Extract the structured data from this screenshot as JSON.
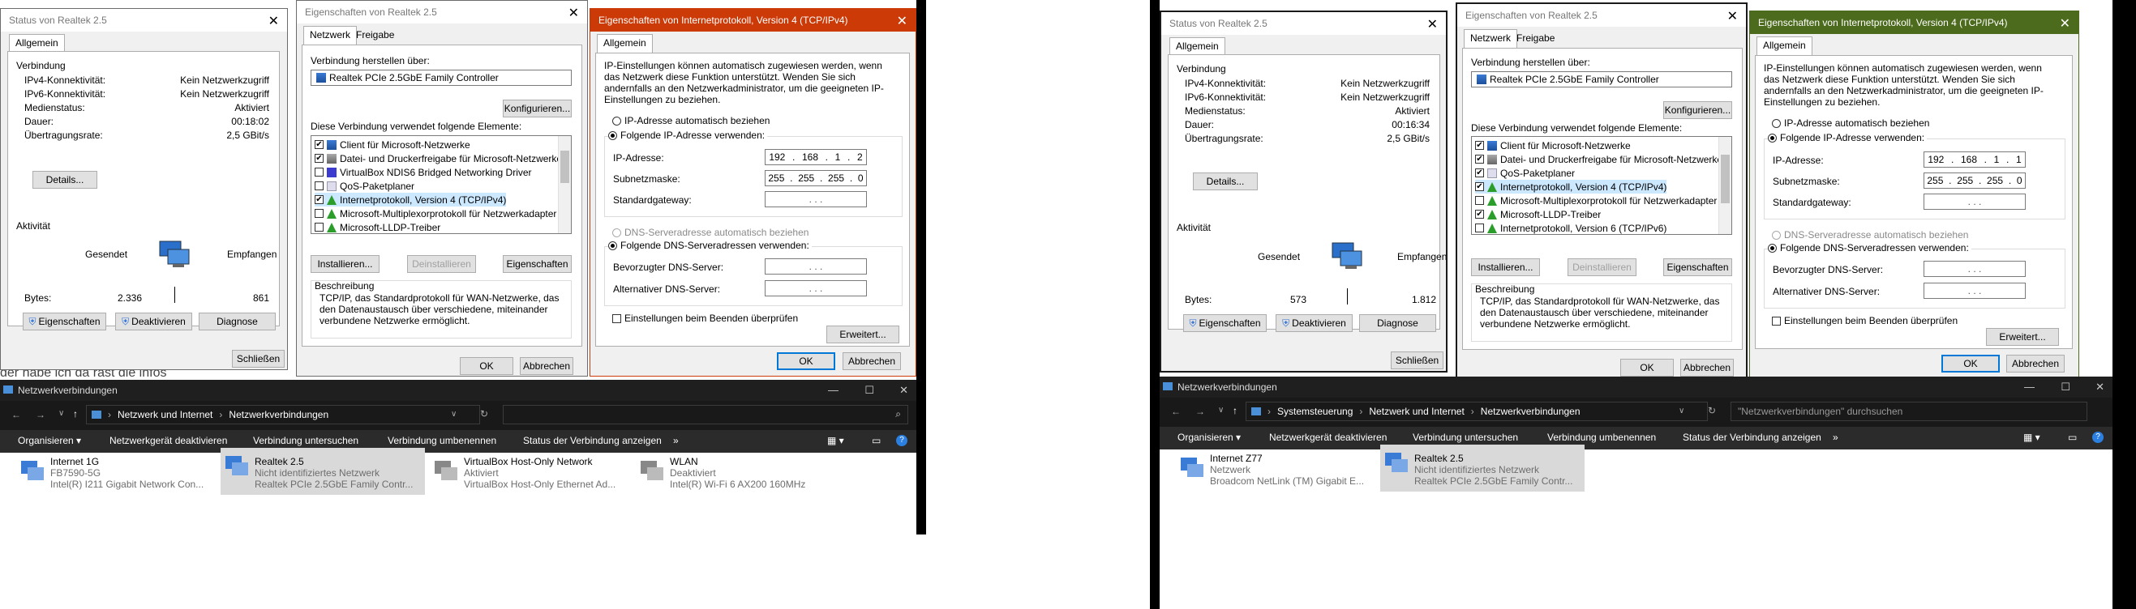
{
  "left": {
    "status": {
      "title": "Status von Realtek 2.5",
      "tab": "Allgemein",
      "group_connection": "Verbindung",
      "rows": [
        {
          "label": "IPv4-Konnektivität:",
          "value": "Kein Netzwerkzugriff"
        },
        {
          "label": "IPv6-Konnektivität:",
          "value": "Kein Netzwerkzugriff"
        },
        {
          "label": "Medienstatus:",
          "value": "Aktiviert"
        },
        {
          "label": "Dauer:",
          "value": "00:18:02"
        },
        {
          "label": "Übertragungsrate:",
          "value": "2,5 GBit/s"
        }
      ],
      "details_btn": "Details...",
      "group_activity": "Aktivität",
      "sent": "Gesendet",
      "received": "Empfangen",
      "bytes_label": "Bytes:",
      "bytes_sent": "2.336",
      "bytes_received": "861",
      "btn_props": "Eigenschaften",
      "btn_disable": "Deaktivieren",
      "btn_diag": "Diagnose",
      "btn_close": "Schließen"
    },
    "props": {
      "title": "Eigenschaften von Realtek 2.5",
      "tab1": "Netzwerk",
      "tab2": "Freigabe",
      "connect_using": "Verbindung herstellen über:",
      "adapter": "Realtek PCIe 2.5GbE Family Controller",
      "configure": "Konfigurieren...",
      "elements_label": "Diese Verbindung verwendet folgende Elemente:",
      "items": [
        {
          "label": "Client für Microsoft-Netzwerke",
          "checked": "✔",
          "icon": "net"
        },
        {
          "label": "Datei- und Druckerfreigabe für Microsoft-Netzwerke",
          "checked": "✔",
          "icon": "prn"
        },
        {
          "label": "VirtualBox NDIS6 Bridged Networking Driver",
          "checked": "",
          "icon": "vb"
        },
        {
          "label": "QoS-Paketplaner",
          "checked": "",
          "icon": "qos"
        },
        {
          "label": "Internetprotokoll, Version 4 (TCP/IPv4)",
          "checked": "✔",
          "icon": "proto"
        },
        {
          "label": "Microsoft-Multiplexorprotokoll für Netzwerkadapter",
          "checked": "",
          "icon": "proto"
        },
        {
          "label": "Microsoft-LLDP-Treiber",
          "checked": "",
          "icon": "proto"
        }
      ],
      "install": "Installieren...",
      "uninstall": "Deinstallieren",
      "properties": "Eigenschaften",
      "desc_label": "Beschreibung",
      "desc_text": "TCP/IP, das Standardprotokoll für WAN-Netzwerke, das den Datenaustausch über verschiedene, miteinander verbundene Netzwerke ermöglicht.",
      "ok": "OK",
      "cancel": "Abbrechen"
    },
    "ipv4": {
      "title": "Eigenschaften von Internetprotokoll, Version 4 (TCP/IPv4)",
      "tab": "Allgemein",
      "intro": "IP-Einstellungen können automatisch zugewiesen werden, wenn das Netzwerk diese Funktion unterstützt. Wenden Sie sich andernfalls an den Netzwerkadministrator, um die geeigneten IP-Einstellungen zu beziehen.",
      "auto_ip": "IP-Adresse automatisch beziehen",
      "manual_ip": "Folgende IP-Adresse verwenden:",
      "ip_label": "IP-Adresse:",
      "ip": [
        "192",
        "168",
        "1",
        "2"
      ],
      "mask_label": "Subnetzmaske:",
      "mask": [
        "255",
        "255",
        "255",
        "0"
      ],
      "gw_label": "Standardgateway:",
      "auto_dns": "DNS-Serveradresse automatisch beziehen",
      "manual_dns": "Folgende DNS-Serveradressen verwenden:",
      "dns1_label": "Bevorzugter DNS-Server:",
      "dns2_label": "Alternativer DNS-Server:",
      "validate": "Einstellungen beim Beenden überprüfen",
      "advanced": "Erweitert...",
      "ok": "OK",
      "cancel": "Abbrechen"
    },
    "background_text": "der habe ich da rast die infos",
    "explorer": {
      "title": "Netzwerkverbindungen",
      "crumb1": "Netzwerk und Internet",
      "crumb2": "Netzwerkverbindungen",
      "toolbar": [
        "Organisieren ▾",
        "Netzwerkgerät deaktivieren",
        "Verbindung untersuchen",
        "Verbindung umbenennen",
        "Status der Verbindung anzeigen",
        "»"
      ],
      "cards": [
        {
          "name": "Internet 1G",
          "status": "FB7590-5G",
          "device": "Intel(R) I211 Gigabit Network Con..."
        },
        {
          "name": "Realtek 2.5",
          "status": "Nicht identifiziertes Netzwerk",
          "device": "Realtek PCIe 2.5GbE Family Contr..."
        },
        {
          "name": "VirtualBox Host-Only Network",
          "status": "Aktiviert",
          "device": "VirtualBox Host-Only Ethernet Ad..."
        },
        {
          "name": "WLAN",
          "status": "Deaktiviert",
          "device": "Intel(R) Wi-Fi 6 AX200 160MHz"
        }
      ]
    }
  },
  "right": {
    "status": {
      "title": "Status von Realtek 2.5",
      "tab": "Allgemein",
      "group_connection": "Verbindung",
      "rows": [
        {
          "label": "IPv4-Konnektivität:",
          "value": "Kein Netzwerkzugriff"
        },
        {
          "label": "IPv6-Konnektivität:",
          "value": "Kein Netzwerkzugriff"
        },
        {
          "label": "Medienstatus:",
          "value": "Aktiviert"
        },
        {
          "label": "Dauer:",
          "value": "00:16:34"
        },
        {
          "label": "Übertragungsrate:",
          "value": "2,5 GBit/s"
        }
      ],
      "details_btn": "Details...",
      "group_activity": "Aktivität",
      "sent": "Gesendet",
      "received": "Empfangen",
      "bytes_label": "Bytes:",
      "bytes_sent": "573",
      "bytes_received": "1.812",
      "btn_props": "Eigenschaften",
      "btn_disable": "Deaktivieren",
      "btn_diag": "Diagnose",
      "btn_close": "Schließen"
    },
    "props": {
      "title": "Eigenschaften von Realtek 2.5",
      "tab1": "Netzwerk",
      "tab2": "Freigabe",
      "connect_using": "Verbindung herstellen über:",
      "adapter": "Realtek PCIe 2.5GbE Family Controller",
      "configure": "Konfigurieren...",
      "elements_label": "Diese Verbindung verwendet folgende Elemente:",
      "items": [
        {
          "label": "Client für Microsoft-Netzwerke",
          "checked": "✔",
          "icon": "net"
        },
        {
          "label": "Datei- und Druckerfreigabe für Microsoft-Netzwerke",
          "checked": "✔",
          "icon": "prn"
        },
        {
          "label": "QoS-Paketplaner",
          "checked": "✔",
          "icon": "qos"
        },
        {
          "label": "Internetprotokoll, Version 4 (TCP/IPv4)",
          "checked": "✔",
          "icon": "proto"
        },
        {
          "label": "Microsoft-Multiplexorprotokoll für Netzwerkadapter",
          "checked": "",
          "icon": "proto"
        },
        {
          "label": "Microsoft-LLDP-Treiber",
          "checked": "✔",
          "icon": "proto"
        },
        {
          "label": "Internetprotokoll, Version 6 (TCP/IPv6)",
          "checked": "",
          "icon": "proto"
        }
      ],
      "install": "Installieren...",
      "uninstall": "Deinstallieren",
      "properties": "Eigenschaften",
      "desc_label": "Beschreibung",
      "desc_text": "TCP/IP, das Standardprotokoll für WAN-Netzwerke, das den Datenaustausch über verschiedene, miteinander verbundene Netzwerke ermöglicht.",
      "ok": "OK",
      "cancel": "Abbrechen"
    },
    "ipv4": {
      "title": "Eigenschaften von Internetprotokoll, Version 4 (TCP/IPv4)",
      "tab": "Allgemein",
      "intro": "IP-Einstellungen können automatisch zugewiesen werden, wenn das Netzwerk diese Funktion unterstützt. Wenden Sie sich andernfalls an den Netzwerkadministrator, um die geeigneten IP-Einstellungen zu beziehen.",
      "auto_ip": "IP-Adresse automatisch beziehen",
      "manual_ip": "Folgende IP-Adresse verwenden:",
      "ip_label": "IP-Adresse:",
      "ip": [
        "192",
        "168",
        "1",
        "1"
      ],
      "mask_label": "Subnetzmaske:",
      "mask": [
        "255",
        "255",
        "255",
        "0"
      ],
      "gw_label": "Standardgateway:",
      "auto_dns": "DNS-Serveradresse automatisch beziehen",
      "manual_dns": "Folgende DNS-Serveradressen verwenden:",
      "dns1_label": "Bevorzugter DNS-Server:",
      "dns2_label": "Alternativer DNS-Server:",
      "validate": "Einstellungen beim Beenden überprüfen",
      "advanced": "Erweitert...",
      "ok": "OK",
      "cancel": "Abbrechen"
    },
    "explorer": {
      "title": "Netzwerkverbindungen",
      "crumb0": "Systemsteuerung",
      "crumb1": "Netzwerk und Internet",
      "crumb2": "Netzwerkverbindungen",
      "search_placeholder": "\"Netzwerkverbindungen\" durchsuchen",
      "toolbar": [
        "Organisieren ▾",
        "Netzwerkgerät deaktivieren",
        "Verbindung untersuchen",
        "Verbindung umbenennen",
        "Status der Verbindung anzeigen",
        "»"
      ],
      "cards": [
        {
          "name": "Internet Z77",
          "status": "Netzwerk",
          "device": "Broadcom NetLink (TM) Gigabit E..."
        },
        {
          "name": "Realtek 2.5",
          "status": "Nicht identifiziertes Netzwerk",
          "device": "Realtek PCIe 2.5GbE Family Contr..."
        }
      ]
    }
  },
  "colors": {
    "active_title_left": "#cc3a08",
    "active_title_right": "#4c6b1d",
    "selection": "#cce8ff",
    "accent": "#0078d7"
  }
}
